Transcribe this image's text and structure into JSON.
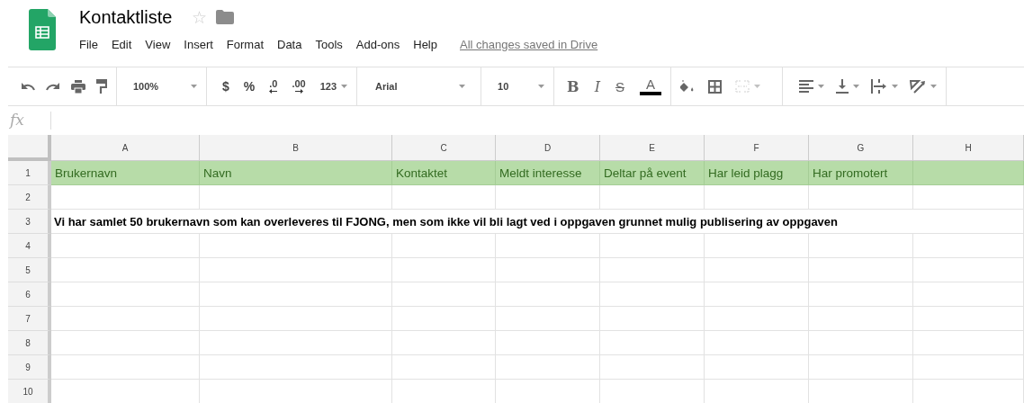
{
  "document": {
    "title": "Kontaktliste",
    "star": "☆",
    "starred": false
  },
  "menu": [
    "File",
    "Edit",
    "View",
    "Insert",
    "Format",
    "Data",
    "Tools",
    "Add-ons",
    "Help"
  ],
  "save_status": "All changes saved in Drive",
  "toolbar": {
    "zoom": "100%",
    "currency": "$",
    "percent": "%",
    "decimal_decrease": ".0",
    "decimal_increase": ".00",
    "number_format": "123",
    "font": "Arial",
    "font_size": "10",
    "bold": "B",
    "italic": "I",
    "strikethrough": "S",
    "text_color": "A",
    "merge_disabled": true
  },
  "formula_bar": {
    "label": "fx"
  },
  "sheet": {
    "columns": [
      "A",
      "B",
      "C",
      "D",
      "E",
      "F",
      "G",
      "H"
    ],
    "rows": [
      {
        "number": "1",
        "kind": "header",
        "cells": [
          "Brukernavn",
          "Navn",
          "Kontaktet",
          "Meldt interesse",
          "Deltar på event",
          "Har leid plagg",
          "Har promotert"
        ]
      },
      {
        "number": "2",
        "kind": "empty"
      },
      {
        "number": "3",
        "kind": "note",
        "text": "Vi har samlet 50 brukernavn som kan overleveres til FJONG, men som ikke vil bli lagt ved i oppgaven grunnet mulig publisering av oppgaven"
      },
      {
        "number": "4",
        "kind": "empty"
      },
      {
        "number": "5",
        "kind": "empty"
      },
      {
        "number": "6",
        "kind": "empty"
      },
      {
        "number": "7",
        "kind": "empty"
      },
      {
        "number": "8",
        "kind": "empty"
      },
      {
        "number": "9",
        "kind": "empty"
      },
      {
        "number": "10",
        "kind": "empty"
      }
    ]
  }
}
